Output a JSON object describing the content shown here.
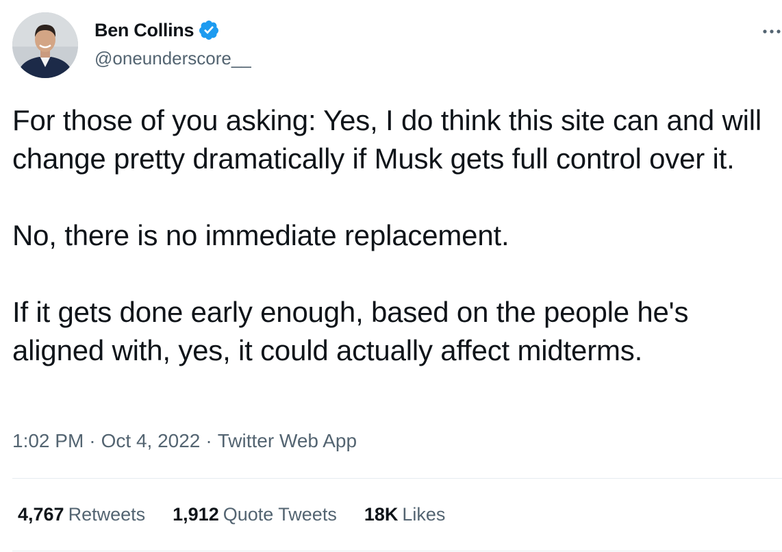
{
  "author": {
    "name": "Ben Collins",
    "handle": "@oneunderscore__",
    "verified": true,
    "verified_color": "#1d9bf0"
  },
  "tweet": {
    "paragraphs": [
      "For those of you asking: Yes, I do think this site can and will change pretty dramatically if Musk gets full control over it.",
      "No, there is no immediate replacement.",
      "If it gets done early enough, based on the people he's aligned with, yes, it could actually affect midterms."
    ]
  },
  "meta": {
    "time": "1:02 PM",
    "separator": "·",
    "date": "Oct 4, 2022",
    "source": "Twitter Web App"
  },
  "stats": {
    "retweets": {
      "count": "4,767",
      "label": "Retweets"
    },
    "quote_tweets": {
      "count": "1,912",
      "label": "Quote Tweets"
    },
    "likes": {
      "count": "18K",
      "label": "Likes"
    }
  },
  "icons": {
    "verified": "verified-badge-icon",
    "more": "more-options-icon"
  },
  "colors": {
    "text": "#0f1419",
    "secondary": "#536471",
    "divider": "#e6ecf0"
  }
}
